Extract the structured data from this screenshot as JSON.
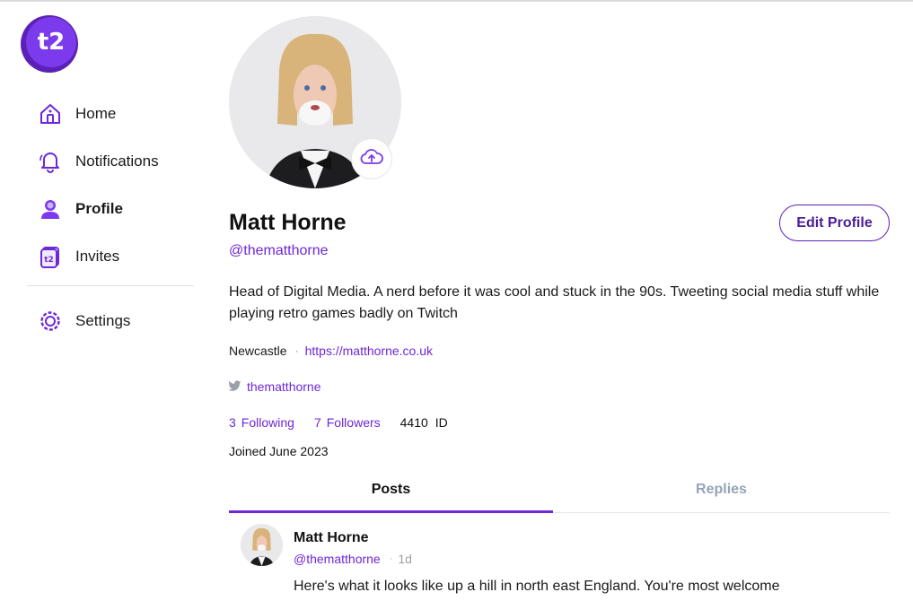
{
  "app": {
    "logo_text": "t2"
  },
  "sidebar": {
    "items": [
      {
        "label": "Home",
        "icon": "home-icon"
      },
      {
        "label": "Notifications",
        "icon": "bell-icon"
      },
      {
        "label": "Profile",
        "icon": "user-icon"
      },
      {
        "label": "Invites",
        "icon": "invite-icon"
      }
    ],
    "settings": {
      "label": "Settings",
      "icon": "gear-icon"
    }
  },
  "profile": {
    "name": "Matt Horne",
    "handle": "@thematthorne",
    "edit_label": "Edit Profile",
    "bio": "Head of Digital Media. A nerd before it was cool and stuck in the 90s. Tweeting social media stuff while playing retro games badly on Twitch",
    "location": "Newcastle",
    "website": "https://matthorne.co.uk",
    "twitter_handle": "thematthorne",
    "following_count": "3",
    "following_label": "Following",
    "followers_count": "7",
    "followers_label": "Followers",
    "id_value": "4410",
    "id_label": "ID",
    "joined": "Joined June 2023"
  },
  "tabs": [
    {
      "label": "Posts",
      "active": true
    },
    {
      "label": "Replies",
      "active": false
    }
  ],
  "post": {
    "author": "Matt Horne",
    "handle": "@thematthorne",
    "time": "1d",
    "text": "Here's what it looks like up a hill in north east England. You're most welcome"
  },
  "colors": {
    "accent": "#6d28d9",
    "accent_dark": "#4c1d95",
    "muted": "#94a3b8"
  }
}
